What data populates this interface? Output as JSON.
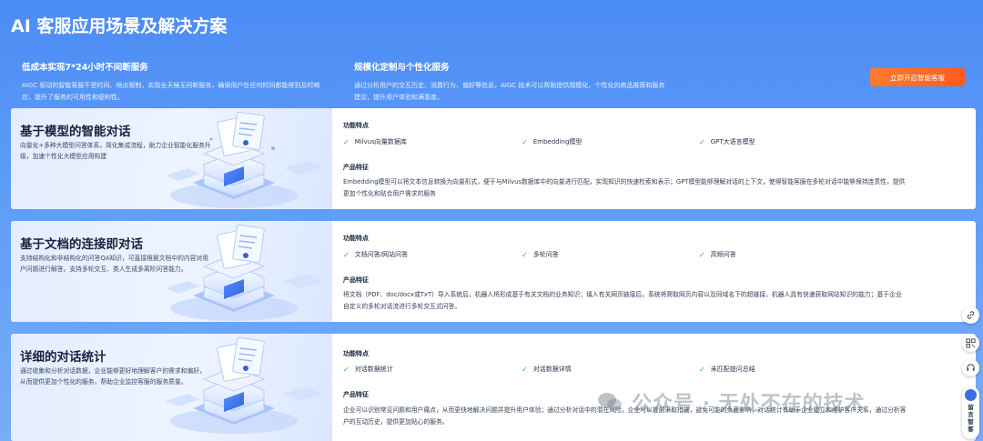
{
  "page": {
    "title": "AI 客服应用场景及解决方案"
  },
  "intro": [
    {
      "title": "低成本实现7*24小时不间断服务",
      "text": "AIGC 驱动的智能客服不受时间、地点限制，实现全天候无间断服务，确保用户在任何时间都能得到及时响应，提升了服务的可用性和便利性。"
    },
    {
      "title": "规模化定制与个性化服务",
      "text": "通过分析用户的交互历史、消费行为、偏好等信息，AIGC 技术可以帮助提供规模化、个性化的商品推荐和服务建议，提升用户体验和满意度。"
    }
  ],
  "cta": {
    "label": "立即开启智能客服"
  },
  "cards": [
    {
      "title": "基于模型的智能对话",
      "subtitle": "向量化+多种大模型问答体系，简化集成流程，助力企业智能化服务升级，加速个性化大模型应用构建",
      "features_label": "功能特点",
      "features": [
        "Milvus向量数据库",
        "Embedding模型",
        "GPT大语言模型"
      ],
      "product_label": "产品特征",
      "product": "Embedding模型可以将文本信息转换为向量形式，便于与Milvus数据库中的向量进行匹配，实现知识的快速检索和表示；GPT模型能够理解对话的上下文，使得智能客服在多轮对话中能够保持连贯性，提供更加个性化和贴合用户需求的服务"
    },
    {
      "title": "基于文档的连接即对话",
      "subtitle": "支持结构化和非结构化的问答QA知识，可直接根据文档中的内容对用户问题进行解答。支持多轮交互、类人生成多离阶问答能力。",
      "features_label": "功能特点",
      "features": [
        "文档问答/网站问答",
        "多轮问答",
        "高频问答"
      ],
      "product_label": "产品特征",
      "product": "将文档（PDF、doc/docx或TxT）导入系统后，机器人将形成基于有关文档的业务知识；填入有关网页链接后，系统将爬取网页内容以及同域名下的超链接，机器人具有快速获取网站知识的能力；基于企业自定义的多轮对话流进行多轮交互式问答。"
    },
    {
      "title": "详细的对话统计",
      "subtitle": "通过收集和分析对话数据，企业能够更好地理解客户的需求和偏好，从而提供更加个性化的服务，帮助企业监控客服的服务质量。",
      "features_label": "功能特点",
      "features": [
        "对话数据统计",
        "对话数据详情",
        "未匹配提问总结"
      ],
      "product_label": "产品特征",
      "product": "企业可以识别常见问题和用户痛点，从而更快地解决问题并提升用户体验；通过分析对话中的潜在风险，企业可以提前采取措施，避免可能的负面影响；对话统计有助于企业建立和维护客户关系，通过分析客户的互动历史，提供更加贴心的服务。"
    }
  ],
  "side": {
    "pill_text": [
      "留",
      "言",
      "智",
      "客"
    ]
  },
  "watermark": {
    "text": "公众号 · 无处不在的技术"
  },
  "colors": {
    "accent": "#ff6a22",
    "check": "#2bb673",
    "bg_top": "#4b8cf5"
  }
}
